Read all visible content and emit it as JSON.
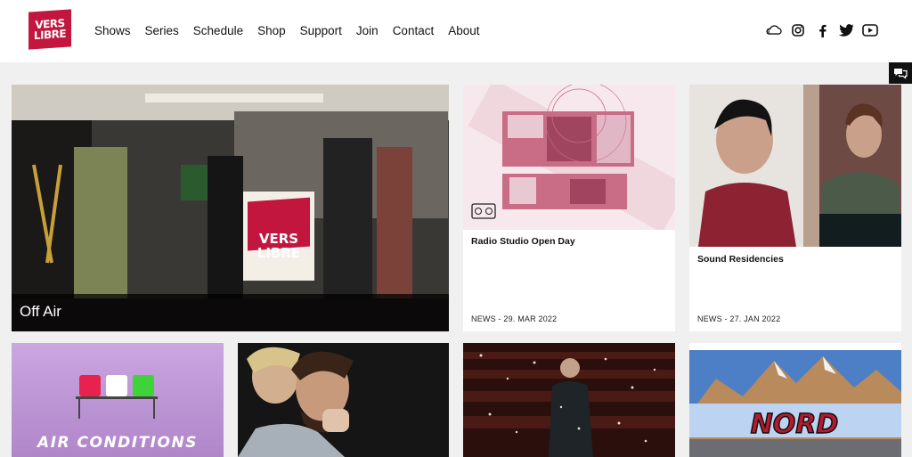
{
  "brand": {
    "logo_line1": "VERS",
    "logo_line2": "LIBRE"
  },
  "nav": {
    "items": [
      {
        "label": "Shows"
      },
      {
        "label": "Series"
      },
      {
        "label": "Schedule"
      },
      {
        "label": "Shop"
      },
      {
        "label": "Support"
      },
      {
        "label": "Join"
      },
      {
        "label": "Contact"
      },
      {
        "label": "About"
      }
    ]
  },
  "social": {
    "icons": [
      "soundcloud-icon",
      "instagram-icon",
      "facebook-icon",
      "twitter-icon",
      "youtube-icon"
    ]
  },
  "feature": {
    "label": "Off Air",
    "sign_line1": "VERS",
    "sign_line2": "LIBRE"
  },
  "cards": [
    {
      "title": "Radio Studio Open Day",
      "meta": "NEWS - 29. MAR 2022"
    },
    {
      "title": "Sound Residencies",
      "meta": "NEWS - 27. JAN 2022"
    }
  ],
  "bottom": {
    "air_conditions": "AIR CONDITIONS",
    "nord": "NORD"
  },
  "colors": {
    "brand": "#c2163e",
    "background": "#f0f0f0"
  }
}
